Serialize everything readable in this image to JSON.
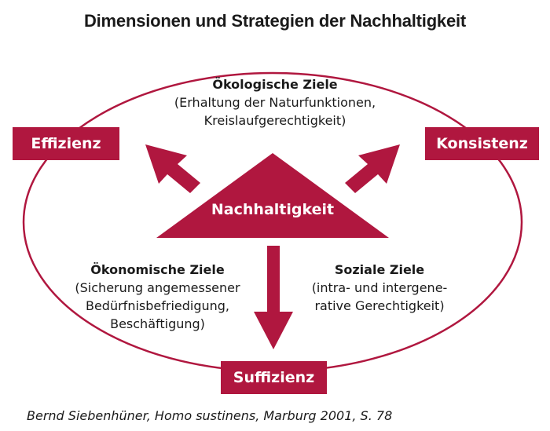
{
  "title": "Dimensionen und Strategien der Nachhaltigkeit",
  "center": "Nachhaltigkeit",
  "strategies": {
    "left": "Effizienz",
    "right": "Konsistenz",
    "bottom": "Suffizienz"
  },
  "goals": {
    "ecological": {
      "heading": "Ökologische Ziele",
      "line1": "(Erhaltung der Naturfunktionen,",
      "line2": "Kreislaufgerechtigkeit)"
    },
    "economic": {
      "heading": "Ökonomische Ziele",
      "line1": "(Sicherung angemessener",
      "line2": "Bedürfnisbefriedigung,",
      "line3": "Beschäftigung)"
    },
    "social": {
      "heading": "Soziale Ziele",
      "line1": "(intra- und intergene-",
      "line2": "rative Gerechtigkeit)"
    }
  },
  "citation": "Bernd Siebenhüner, Homo sustinens, Marburg 2001, S. 78",
  "colors": {
    "accent": "#b0173f"
  }
}
